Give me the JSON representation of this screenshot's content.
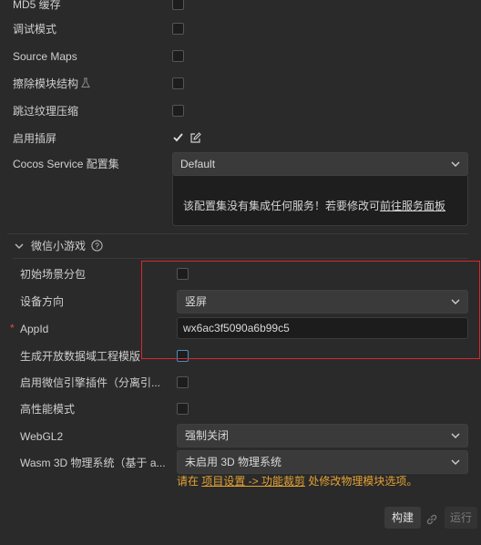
{
  "rows": {
    "md5": "MD5 缓存",
    "debug": "调试模式",
    "source_maps": "Source Maps",
    "erase_module": "擦除模块结构",
    "skip_compress": "跳过纹理压缩",
    "splash": "启用插屏",
    "cocos_service": "Cocos Service 配置集"
  },
  "cocos_service": {
    "selected": "Default",
    "info_text": "该配置集没有集成任何服务！若要修改可",
    "info_link": "前往服务面板"
  },
  "wechat": {
    "section_title": "微信小游戏",
    "initial_scene_subpackage": "初始场景分包",
    "orientation_label": "设备方向",
    "orientation_value": "竖屏",
    "appid_required": "*",
    "appid_label": "AppId",
    "appid_value": "wx6ac3f5090a6b99c5",
    "open_data": "生成开放数据域工程模版",
    "engine_plugin": "启用微信引擎插件（分离引...",
    "high_perf": "高性能模式",
    "webgl2_label": "WebGL2",
    "webgl2_value": "强制关闭",
    "wasm_label": "Wasm 3D 物理系统（基于 a...",
    "wasm_value": "未启用 3D 物理系统",
    "wasm_hint_pre": "请在 ",
    "wasm_hint_link": "项目设置 -> 功能裁剪",
    "wasm_hint_post": " 处修改物理模块选项。"
  },
  "footer": {
    "build": "构建",
    "run": "运行"
  },
  "colors": {
    "background": "#2a2a2a",
    "highlight_border": "#d8282e",
    "hint_orange": "#e5a233"
  }
}
